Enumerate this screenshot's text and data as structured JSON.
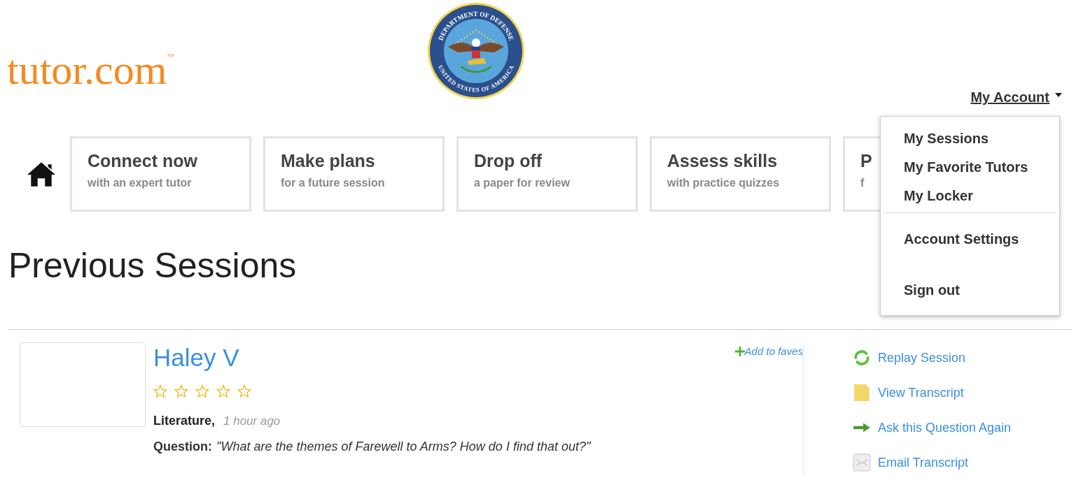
{
  "logo": {
    "text": "tutor.com$^{™}$"
  },
  "seal": {
    "top_text": "DEPARTMENT OF DEFENSE",
    "bottom_text": "UNITED STATES OF AMERICA"
  },
  "account_menu": {
    "label": "My Account",
    "expanded": true,
    "items": [
      {
        "kind": "link",
        "label": "My Sessions"
      },
      {
        "kind": "link",
        "label": "My Favorite Tutors"
      },
      {
        "kind": "link",
        "label": "My Locker"
      },
      {
        "kind": "divider"
      },
      {
        "kind": "link",
        "label": "Account Settings"
      },
      {
        "kind": "spacer"
      },
      {
        "kind": "link",
        "label": "Sign out"
      }
    ]
  },
  "nav_cards": [
    {
      "title": "Connect now",
      "subtitle": "with an expert tutor"
    },
    {
      "title": "Make plans",
      "subtitle": "for a future session"
    },
    {
      "title": "Drop off",
      "subtitle": "a paper for review"
    },
    {
      "title": "Assess skills",
      "subtitle": "with practice quizzes"
    },
    {
      "title": "P",
      "subtitle": "f"
    }
  ],
  "page_title": "Previous Sessions",
  "sessions": [
    {
      "tutor": "Haley V",
      "stars": 0,
      "add_to_faves": "Add to faves",
      "subject": "Literature,",
      "time": "1 hour ago",
      "question_label": "Question:",
      "question": "\"What are the themes of Farewell to Arms? How do I find that out?\"",
      "actions": [
        {
          "kind": "replay",
          "label": "Replay Session"
        },
        {
          "kind": "transcript",
          "label": "View Transcript"
        },
        {
          "kind": "ask",
          "label": "Ask this Question Again"
        },
        {
          "kind": "email",
          "label": "Email Transcript"
        }
      ]
    }
  ]
}
